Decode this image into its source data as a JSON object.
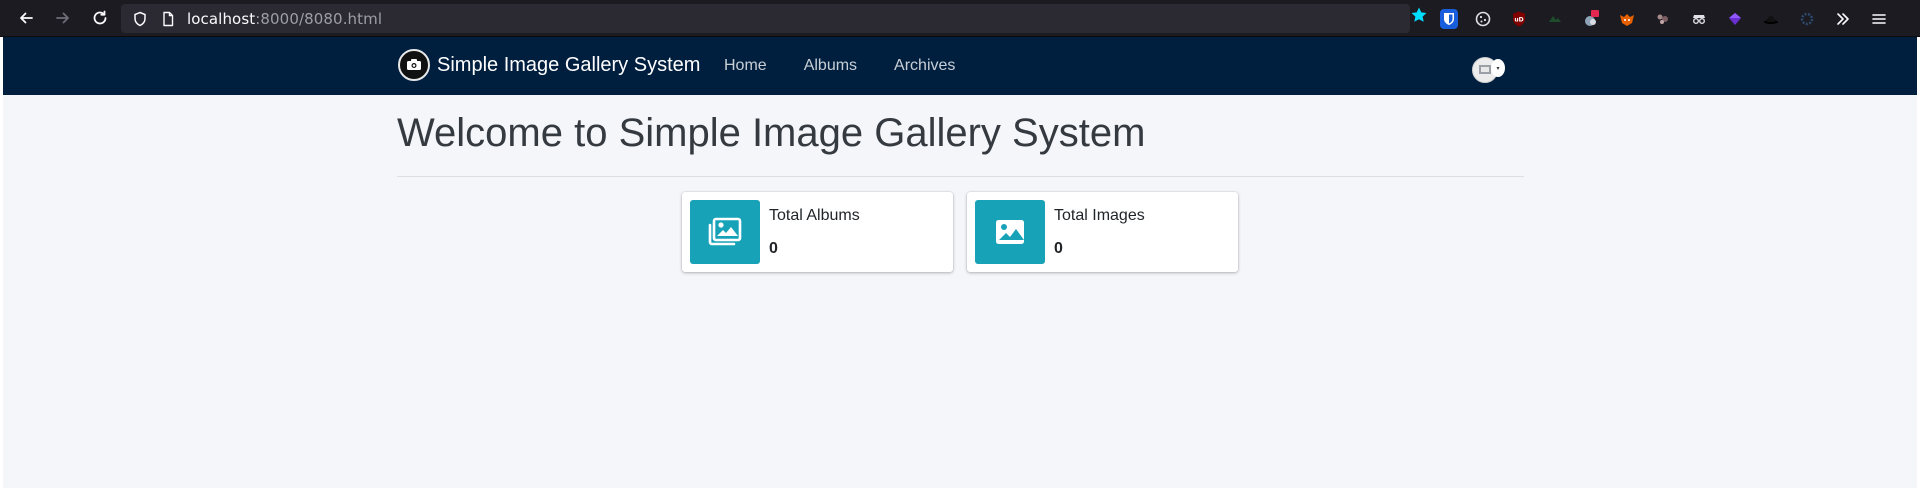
{
  "browser": {
    "url_host": "localhost",
    "url_path": ":8000/8080.html"
  },
  "site": {
    "brand": "Simple Image Gallery System",
    "menu": [
      {
        "label": "Home"
      },
      {
        "label": "Albums"
      },
      {
        "label": "Archives"
      }
    ]
  },
  "main": {
    "title": "Welcome to Simple Image Gallery System",
    "cards": [
      {
        "label": "Total Albums",
        "value": "0",
        "icon": "images-icon"
      },
      {
        "label": "Total Images",
        "value": "0",
        "icon": "image-icon"
      }
    ]
  },
  "colors": {
    "navbar": "#001f3f",
    "card_icon_bg": "#17a2b8",
    "page_bg": "#f4f6f9",
    "bookmark_star": "#00ddff"
  }
}
